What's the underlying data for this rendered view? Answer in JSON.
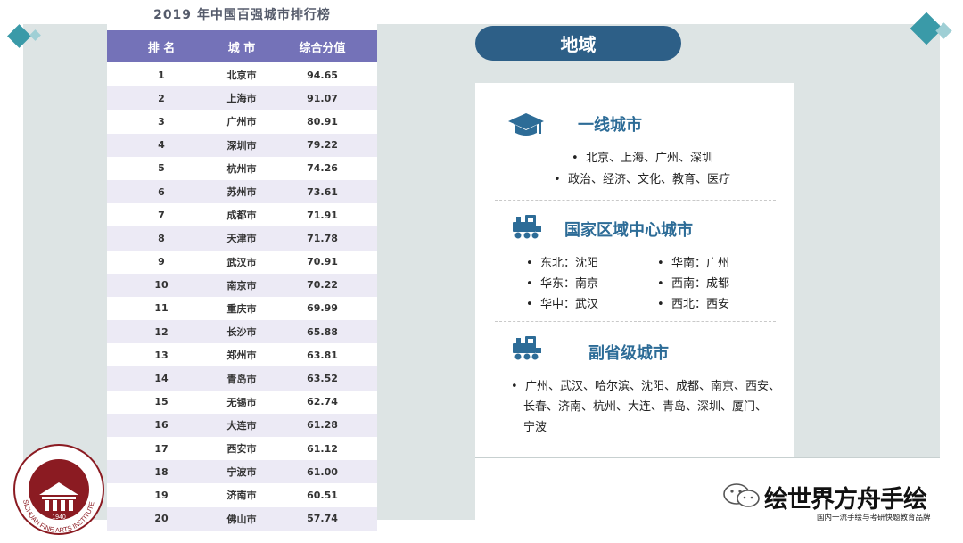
{
  "ranking": {
    "title": "2019 年中国百强城市排行榜",
    "columns": [
      "排 名",
      "城 市",
      "综合分值"
    ],
    "rows": [
      [
        "1",
        "北京市",
        "94.65"
      ],
      [
        "2",
        "上海市",
        "91.07"
      ],
      [
        "3",
        "广州市",
        "80.91"
      ],
      [
        "4",
        "深圳市",
        "79.22"
      ],
      [
        "5",
        "杭州市",
        "74.26"
      ],
      [
        "6",
        "苏州市",
        "73.61"
      ],
      [
        "7",
        "成都市",
        "71.91"
      ],
      [
        "8",
        "天津市",
        "71.78"
      ],
      [
        "9",
        "武汉市",
        "70.91"
      ],
      [
        "10",
        "南京市",
        "70.22"
      ],
      [
        "11",
        "重庆市",
        "69.99"
      ],
      [
        "12",
        "长沙市",
        "65.88"
      ],
      [
        "13",
        "郑州市",
        "63.81"
      ],
      [
        "14",
        "青岛市",
        "63.52"
      ],
      [
        "15",
        "无锡市",
        "62.74"
      ],
      [
        "16",
        "大连市",
        "61.28"
      ],
      [
        "17",
        "西安市",
        "61.12"
      ],
      [
        "18",
        "宁波市",
        "61.00"
      ],
      [
        "19",
        "济南市",
        "60.51"
      ],
      [
        "20",
        "佛山市",
        "57.74"
      ]
    ]
  },
  "region": {
    "header": "地域",
    "tier1": {
      "title": "一线城市",
      "bullets": [
        "北京、上海、广州、深圳",
        "政治、经济、文化、教育、医疗"
      ]
    },
    "national": {
      "title": "国家区域中心城市",
      "left": [
        "东北：沈阳",
        "华东：南京",
        "华中：武汉"
      ],
      "right": [
        "华南：广州",
        "西南：成都",
        "西北：西安"
      ]
    },
    "sub": {
      "title": "副省级城市",
      "lines": [
        "广州、武汉、哈尔滨、沈阳、成都、南京、西安、",
        "长春、济南、杭州、大连、青岛、深圳、厦门、",
        "宁波"
      ]
    }
  },
  "seal": {
    "text": "SICHUAN FINE ARTS INSTITUTE",
    "year": "1940"
  },
  "watermark": {
    "name": "绘世界方舟手绘",
    "tagline": "国内一流手绘与考研快题教育品牌"
  },
  "colors": {
    "accent": "#2d6c97",
    "pill": "#2d5f87",
    "table_header": "#7472b8",
    "seal": "#8b1b22"
  }
}
